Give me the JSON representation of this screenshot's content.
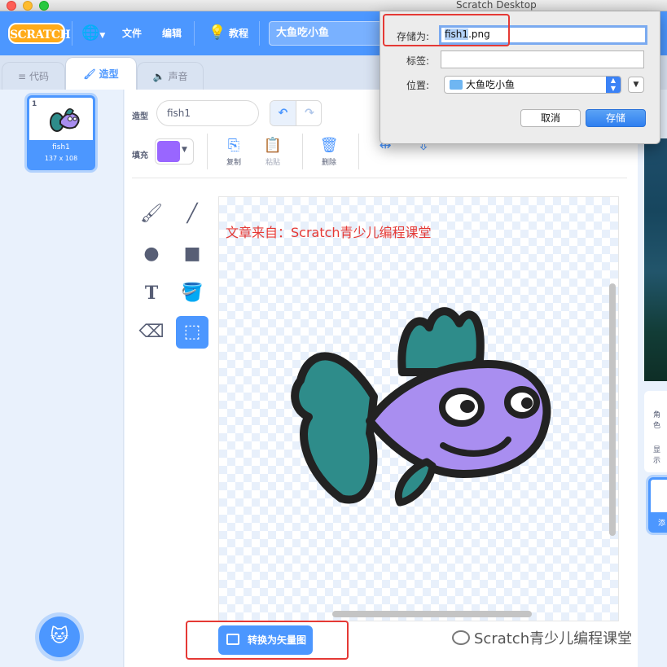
{
  "window": {
    "title": "Scratch Desktop"
  },
  "menubar": {
    "logo": "SCRATCH",
    "file": "文件",
    "edit": "编辑",
    "tutorials": "教程",
    "project_title": "大鱼吃小鱼"
  },
  "tabs": [
    {
      "label": "代码",
      "icon": "code-icon"
    },
    {
      "label": "造型",
      "icon": "brush-icon",
      "active": true
    },
    {
      "label": "声音",
      "icon": "speaker-icon"
    }
  ],
  "costume_list": [
    {
      "index": "1",
      "name": "fish1",
      "size": "137 x 108"
    }
  ],
  "paint_editor": {
    "costume_label": "造型",
    "costume_name": "fish1",
    "fill_label": "填充",
    "fill_color": "#9966ff",
    "copy_label": "复制",
    "paste_label": "粘贴",
    "delete_label": "删除",
    "convert_button": "转换为矢量图"
  },
  "canvas_note": "文章来自：Scratch青少儿编程课堂",
  "save_dialog": {
    "save_as_label": "存储为:",
    "filename_selected": "fish1",
    "filename_ext": ".png",
    "tags_label": "标签:",
    "location_label": "位置:",
    "location_value": "大鱼吃小鱼",
    "cancel": "取消",
    "save": "存储"
  },
  "stage_panel": {
    "sprite_label": "角色",
    "show_label": "显示",
    "add_label": "添"
  },
  "watermark": "Scratch青少儿编程课堂"
}
